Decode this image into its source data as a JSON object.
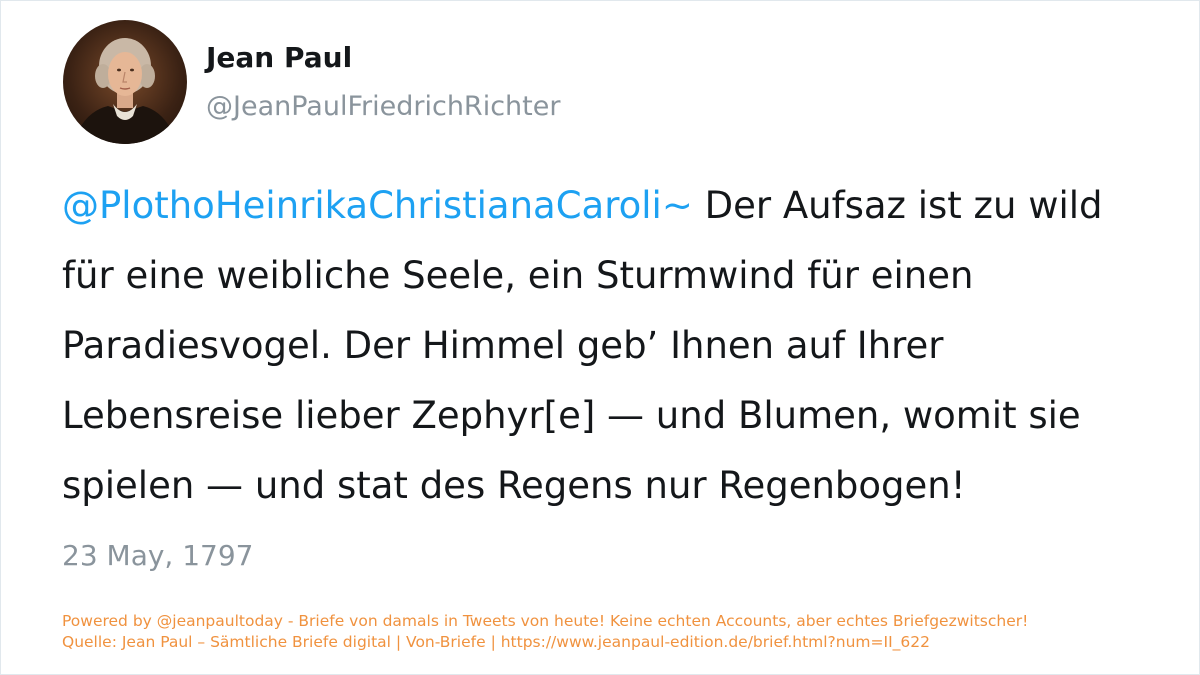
{
  "author": {
    "name": "Jean Paul",
    "handle": "@JeanPaulFriedrichRichter",
    "avatar_icon": "portrait-avatar-icon"
  },
  "tweet": {
    "mention": "@PlothoHeinrikaChristianaCaroli~",
    "text": " Der Aufsaz ist zu wild für eine weibliche Seele, ein Sturmwind für einen Paradiesvogel. Der Himmel geb’ Ihnen auf Ihrer Lebensreise lieber Zephyr[e] — und Blumen, womit sie spielen — und stat des Regens nur Regenbogen!",
    "date": "23 May, 1797"
  },
  "footer": {
    "powered_by": "Powered by @jeanpaultoday - Briefe von damals in Tweets von heute! Keine echten Accounts, aber echtes Briefgezwitscher!",
    "source": "Quelle: Jean Paul – Sämtliche Briefe digital | Von-Briefe | https://www.jeanpaul-edition.de/brief.html?num=II_622"
  },
  "colors": {
    "mention": "#1da1f2",
    "text": "#14171a",
    "muted": "#8a949c",
    "footer": "#f0923f"
  }
}
